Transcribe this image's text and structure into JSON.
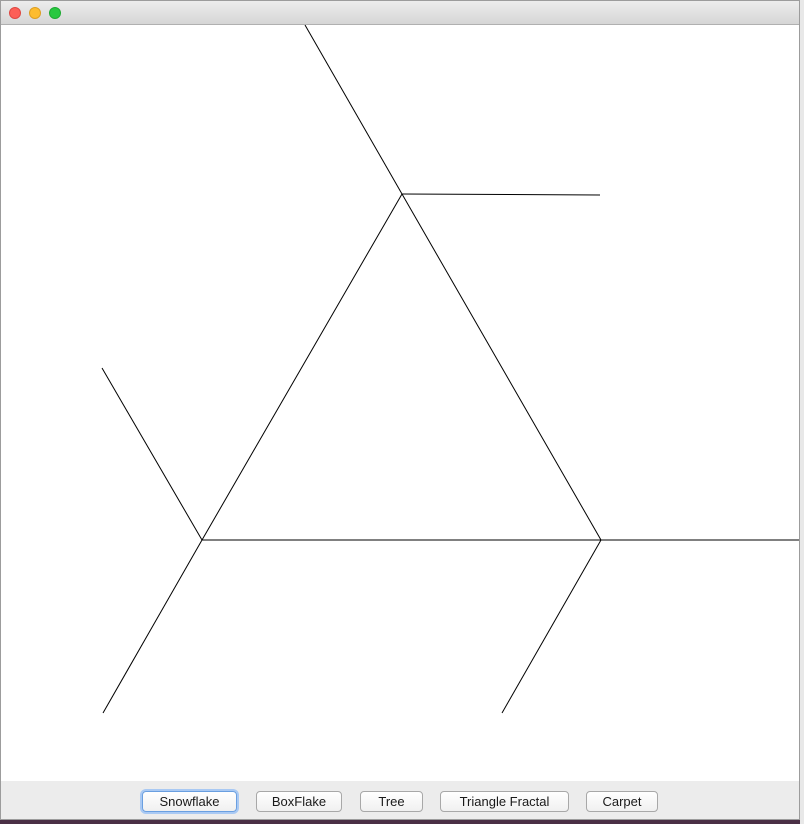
{
  "window": {
    "title": ""
  },
  "buttons": {
    "snowflake": "Snowflake",
    "boxflake": "BoxFlake",
    "tree": "Tree",
    "triangle_fractal": "Triangle Fractal",
    "carpet": "Carpet"
  },
  "selected_button": "snowflake",
  "colors": {
    "stroke": "#000000",
    "canvas_background": "#ffffff",
    "focus_ring": "#a9c9f3"
  }
}
